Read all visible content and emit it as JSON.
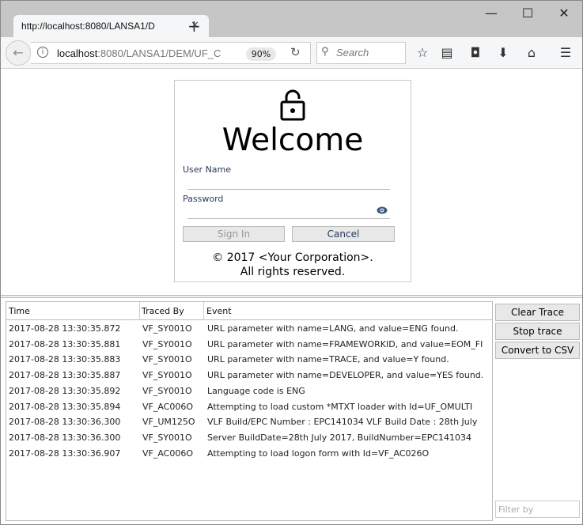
{
  "browser": {
    "tab_title": "http://localhost:8080/LANSA1/D",
    "url_host": "localhost",
    "url_rest": ":8080/LANSA1/DEM/UF_C",
    "zoom": "90%",
    "search_placeholder": "Search"
  },
  "login": {
    "title": "Welcome",
    "username_label": "User Name",
    "password_label": "Password",
    "sign_in": "Sign In",
    "cancel": "Cancel",
    "copyright_line1": "© 2017 <Your Corporation>.",
    "copyright_line2": "All rights reserved."
  },
  "trace": {
    "columns": [
      "Time",
      "Traced By",
      "Event"
    ],
    "rows": [
      [
        "2017-08-28 13:30:35.872",
        "VF_SY001O",
        "URL parameter with name=LANG, and value=ENG found."
      ],
      [
        "2017-08-28 13:30:35.881",
        "VF_SY001O",
        "URL parameter with name=FRAMEWORKID, and value=EOM_FI"
      ],
      [
        "2017-08-28 13:30:35.883",
        "VF_SY001O",
        "URL parameter with name=TRACE, and value=Y found."
      ],
      [
        "2017-08-28 13:30:35.887",
        "VF_SY001O",
        "URL parameter with name=DEVELOPER, and value=YES found."
      ],
      [
        "2017-08-28 13:30:35.892",
        "VF_SY001O",
        "Language code is ENG"
      ],
      [
        "2017-08-28 13:30:35.894",
        "VF_AC006O",
        "Attempting to load custom *MTXT loader with Id=UF_OMULTI"
      ],
      [
        "2017-08-28 13:30:36.300",
        "VF_UM125O",
        "VLF Build/EPC  Number : EPC141034 VLF Build Date : 28th July"
      ],
      [
        "2017-08-28 13:30:36.300",
        "VF_SY001O",
        "Server BuildDate=28th July 2017, BuildNumber=EPC141034"
      ],
      [
        "2017-08-28 13:30:36.907",
        "VF_AC006O",
        "Attempting to load logon form with Id=VF_AC026O"
      ]
    ],
    "clear_label": "Clear Trace",
    "stop_label": "Stop trace",
    "csv_label": "Convert to CSV",
    "filter_placeholder": "Filter by"
  }
}
